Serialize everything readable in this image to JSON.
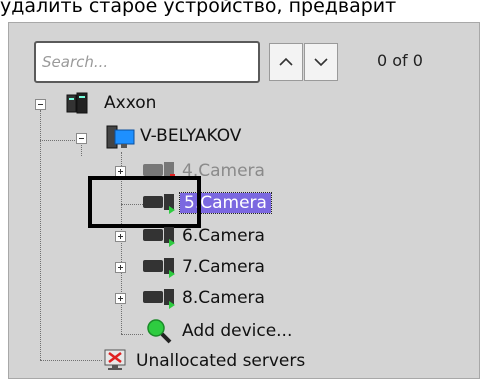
{
  "caption": "удалить старое устройство, предварит",
  "search": {
    "placeholder": "Search...",
    "value": ""
  },
  "nav": {
    "up_icon": "chevron-up-icon",
    "down_icon": "chevron-down-icon"
  },
  "match_count": "0 of 0",
  "tree": {
    "root": "Axxon",
    "server": "V-BELYAKOV",
    "cameras": [
      "4.Camera",
      "5.Camera",
      "6.Camera",
      "7.Camera",
      "8.Camera"
    ],
    "add_device": "Add device...",
    "unallocated": "Unallocated servers"
  },
  "colors": {
    "selection": "#7b68e0",
    "panel": "#d4d4d4",
    "status_green": "#2ecc40",
    "status_red": "#e02020"
  }
}
